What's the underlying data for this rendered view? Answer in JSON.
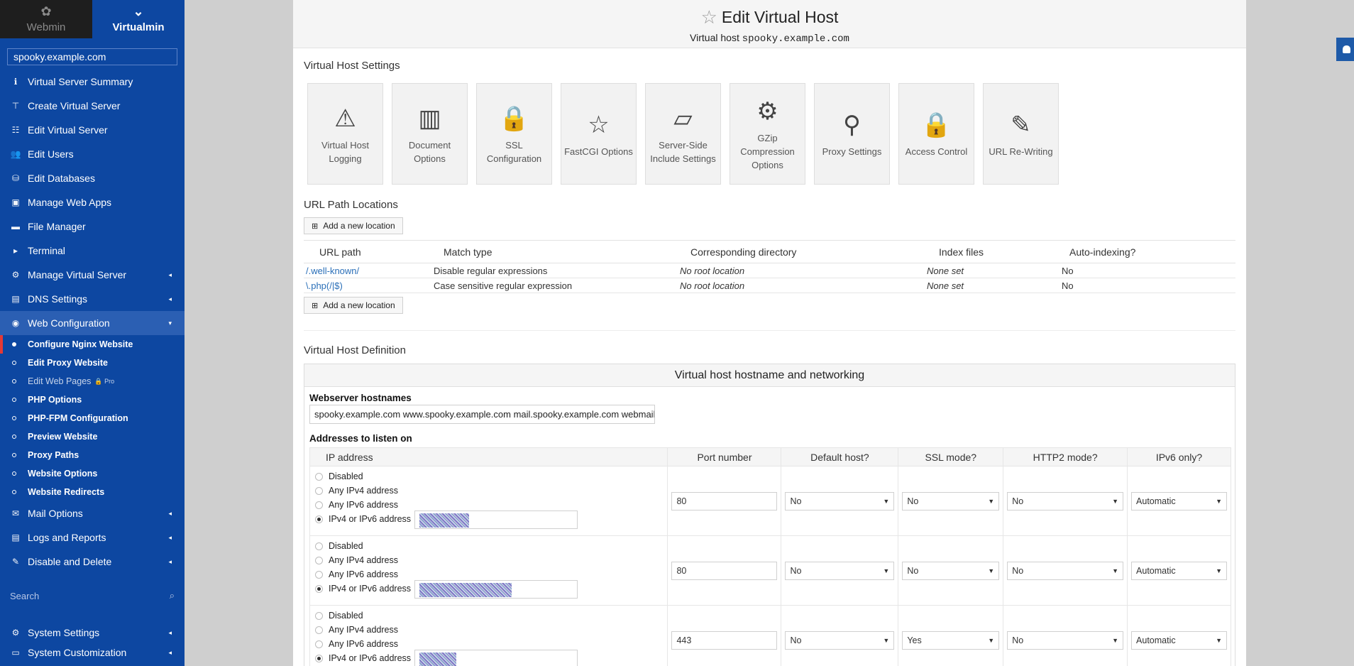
{
  "switcher": {
    "webmin": "Webmin",
    "virtualmin": "Virtualmin"
  },
  "domain": "spooky.example.com",
  "nav": [
    {
      "label": "Virtual Server Summary",
      "icon": "ℹ"
    },
    {
      "label": "Create Virtual Server",
      "icon": "⊤"
    },
    {
      "label": "Edit Virtual Server",
      "icon": "☷"
    },
    {
      "label": "Edit Users",
      "icon": "👥"
    },
    {
      "label": "Edit Databases",
      "icon": "⛁"
    },
    {
      "label": "Manage Web Apps",
      "icon": "▣"
    },
    {
      "label": "File Manager",
      "icon": "▬"
    },
    {
      "label": "Terminal",
      "icon": "▸"
    },
    {
      "label": "Manage Virtual Server",
      "icon": "⚙"
    },
    {
      "label": "DNS Settings",
      "icon": "▤"
    },
    {
      "label": "Web Configuration",
      "icon": "◉"
    }
  ],
  "sub": [
    {
      "label": "Configure Nginx Website"
    },
    {
      "label": "Edit Proxy Website"
    },
    {
      "label": "Edit Web Pages",
      "badge": "Pro"
    },
    {
      "label": "PHP Options"
    },
    {
      "label": "PHP-FPM Configuration"
    },
    {
      "label": "Preview Website"
    },
    {
      "label": "Proxy Paths"
    },
    {
      "label": "Website Options"
    },
    {
      "label": "Website Redirects"
    }
  ],
  "nav2": [
    {
      "label": "Mail Options",
      "icon": "✉"
    },
    {
      "label": "Logs and Reports",
      "icon": "▤"
    },
    {
      "label": "Disable and Delete",
      "icon": "✎"
    }
  ],
  "search_placeholder": "Search",
  "bottom": [
    {
      "label": "System Settings",
      "icon": "⚙"
    },
    {
      "label": "System Customization",
      "icon": "▭"
    }
  ],
  "page": {
    "title": "Edit Virtual Host",
    "subtitle_prefix": "Virtual host ",
    "subtitle_host": "spooky.example.com"
  },
  "vhs": {
    "title": "Virtual Host Settings",
    "icons": [
      {
        "line1": "Virtual Host",
        "line2": "Logging",
        "line3": "",
        "glyph": "⚠"
      },
      {
        "line1": "Document",
        "line2": "Options",
        "line3": "",
        "glyph": "▥"
      },
      {
        "line1": "SSL",
        "line2": "Configuration",
        "line3": "",
        "glyph": "🔒"
      },
      {
        "line1": "FastCGI Options",
        "line2": "",
        "line3": "",
        "glyph": "☆"
      },
      {
        "line1": "Server-Side",
        "line2": "Include Settings",
        "line3": "",
        "glyph": "▱"
      },
      {
        "line1": "GZip",
        "line2": "Compression",
        "line3": "Options",
        "glyph": "⚙"
      },
      {
        "line1": "Proxy Settings",
        "line2": "",
        "line3": "",
        "glyph": "⚲"
      },
      {
        "line1": "Access Control",
        "line2": "",
        "line3": "",
        "glyph": "🔒"
      },
      {
        "line1": "URL Re-Writing",
        "line2": "",
        "line3": "",
        "glyph": "✎"
      }
    ]
  },
  "locations": {
    "title": "URL Path Locations",
    "add_label": "Add a new location",
    "headers": [
      "URL path",
      "Match type",
      "Corresponding directory",
      "Index files",
      "Auto-indexing?"
    ],
    "rows": [
      [
        "/.well-known/",
        "Disable regular expressions",
        "No root location",
        "None set",
        "No"
      ],
      [
        "\\.php(/|$)",
        "Case sensitive regular expression",
        "No root location",
        "None set",
        "No"
      ]
    ]
  },
  "definition": {
    "title": "Virtual Host Definition",
    "box_title": "Virtual host hostname and networking",
    "hostnames_label": "Webserver hostnames",
    "hostnames_value": "spooky.example.com www.spooky.example.com mail.spooky.example.com webmail.spooky.example.com",
    "addresses_label": "Addresses to listen on",
    "headers": [
      "IP address",
      "Port number",
      "Default host?",
      "SSL mode?",
      "HTTP2 mode?",
      "IPv6 only?"
    ],
    "radio_labels": [
      "Disabled",
      "Any IPv4 address",
      "Any IPv6 address",
      "IPv4 or IPv6 address"
    ],
    "rows": [
      {
        "port": "80",
        "default": "No",
        "ssl": "No",
        "http2": "No",
        "ipv6": "Automatic"
      },
      {
        "port": "80",
        "default": "No",
        "ssl": "No",
        "http2": "No",
        "ipv6": "Automatic"
      },
      {
        "port": "443",
        "default": "No",
        "ssl": "Yes",
        "http2": "No",
        "ipv6": "Automatic"
      }
    ]
  }
}
